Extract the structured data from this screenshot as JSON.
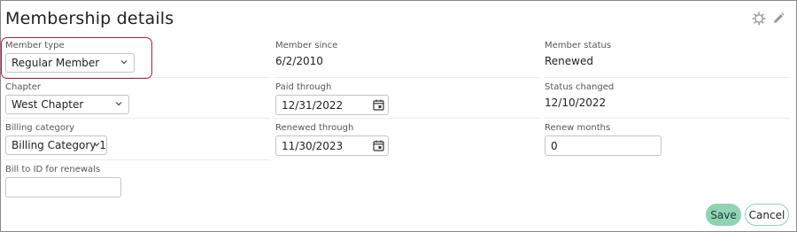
{
  "header": {
    "title": "Membership details",
    "settings_icon": "gear-icon",
    "edit_icon": "pencil-icon"
  },
  "col1": {
    "member_type": {
      "label": "Member type",
      "value": "Regular Member"
    },
    "chapter": {
      "label": "Chapter",
      "value": "West Chapter"
    },
    "billing_category": {
      "label": "Billing category",
      "value": "Billing Category 1"
    },
    "bill_to": {
      "label": "Bill to ID for renewals",
      "value": ""
    }
  },
  "col2": {
    "member_since": {
      "label": "Member since",
      "value": "6/2/2010"
    },
    "paid_through": {
      "label": "Paid through",
      "value": "12/31/2022"
    },
    "renewed_through": {
      "label": "Renewed through",
      "value": "11/30/2023"
    }
  },
  "col3": {
    "member_status": {
      "label": "Member status",
      "value": "Renewed"
    },
    "status_changed": {
      "label": "Status changed",
      "value": "12/10/2022"
    },
    "renew_months": {
      "label": "Renew months",
      "value": "0"
    }
  },
  "actions": {
    "save": "Save",
    "cancel": "Cancel"
  },
  "colors": {
    "highlight": "#a3233a",
    "save_bg": "#8fd3b3"
  }
}
